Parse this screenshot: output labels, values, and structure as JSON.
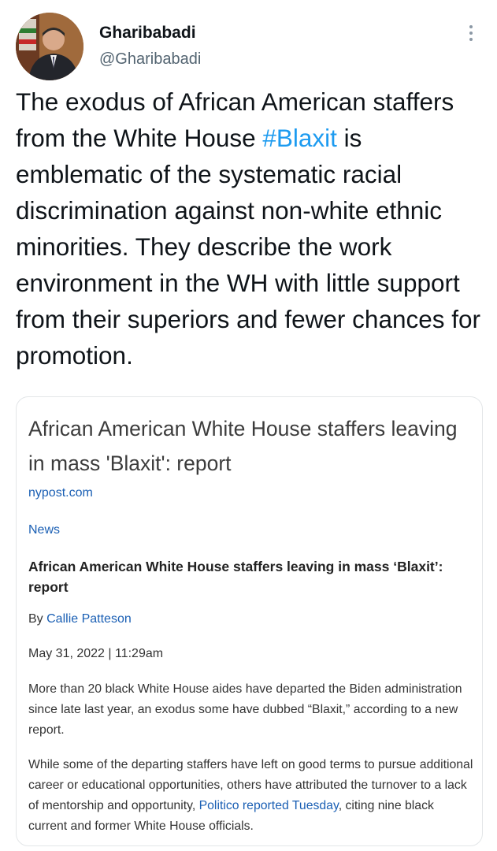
{
  "tweet": {
    "display_name": "Gharibabadi",
    "handle": "@Gharibabadi",
    "text_before": "The exodus of African American staffers from the White House ",
    "hashtag": "#Blaxit",
    "text_after": " is emblematic of the systematic racial discrimination against non-white ethnic minorities. They describe the work environment in the WH with little support from their superiors and fewer chances for promotion.",
    "more_icon": "more-vertical-icon"
  },
  "card": {
    "headline": "African American White House staffers leaving in mass 'Blaxit': report",
    "source": "nypost.com",
    "section": "News",
    "article_title": "African American White House staffers leaving in mass ‘Blaxit’: report",
    "byline_prefix": "By ",
    "author": "Callie Patteson",
    "dateline": "May 31, 2022 | 11:29am",
    "para1": "More than 20 black White House aides have departed the Biden administration since late last year, an exodus some have dubbed “Blaxit,” according to a new report.",
    "para2_before": "While some of the departing staffers have left on good terms to pursue additional career or educational opportunities, others have attributed the turnover to a lack of mentorship and opportunity, ",
    "para2_link": "Politico reported Tuesday",
    "para2_after": ", citing nine black current and former White House officials."
  },
  "colors": {
    "hashtag": "#1d9bf0",
    "link": "#1a5fb4",
    "text": "#0f1419",
    "secondary": "#536471"
  }
}
